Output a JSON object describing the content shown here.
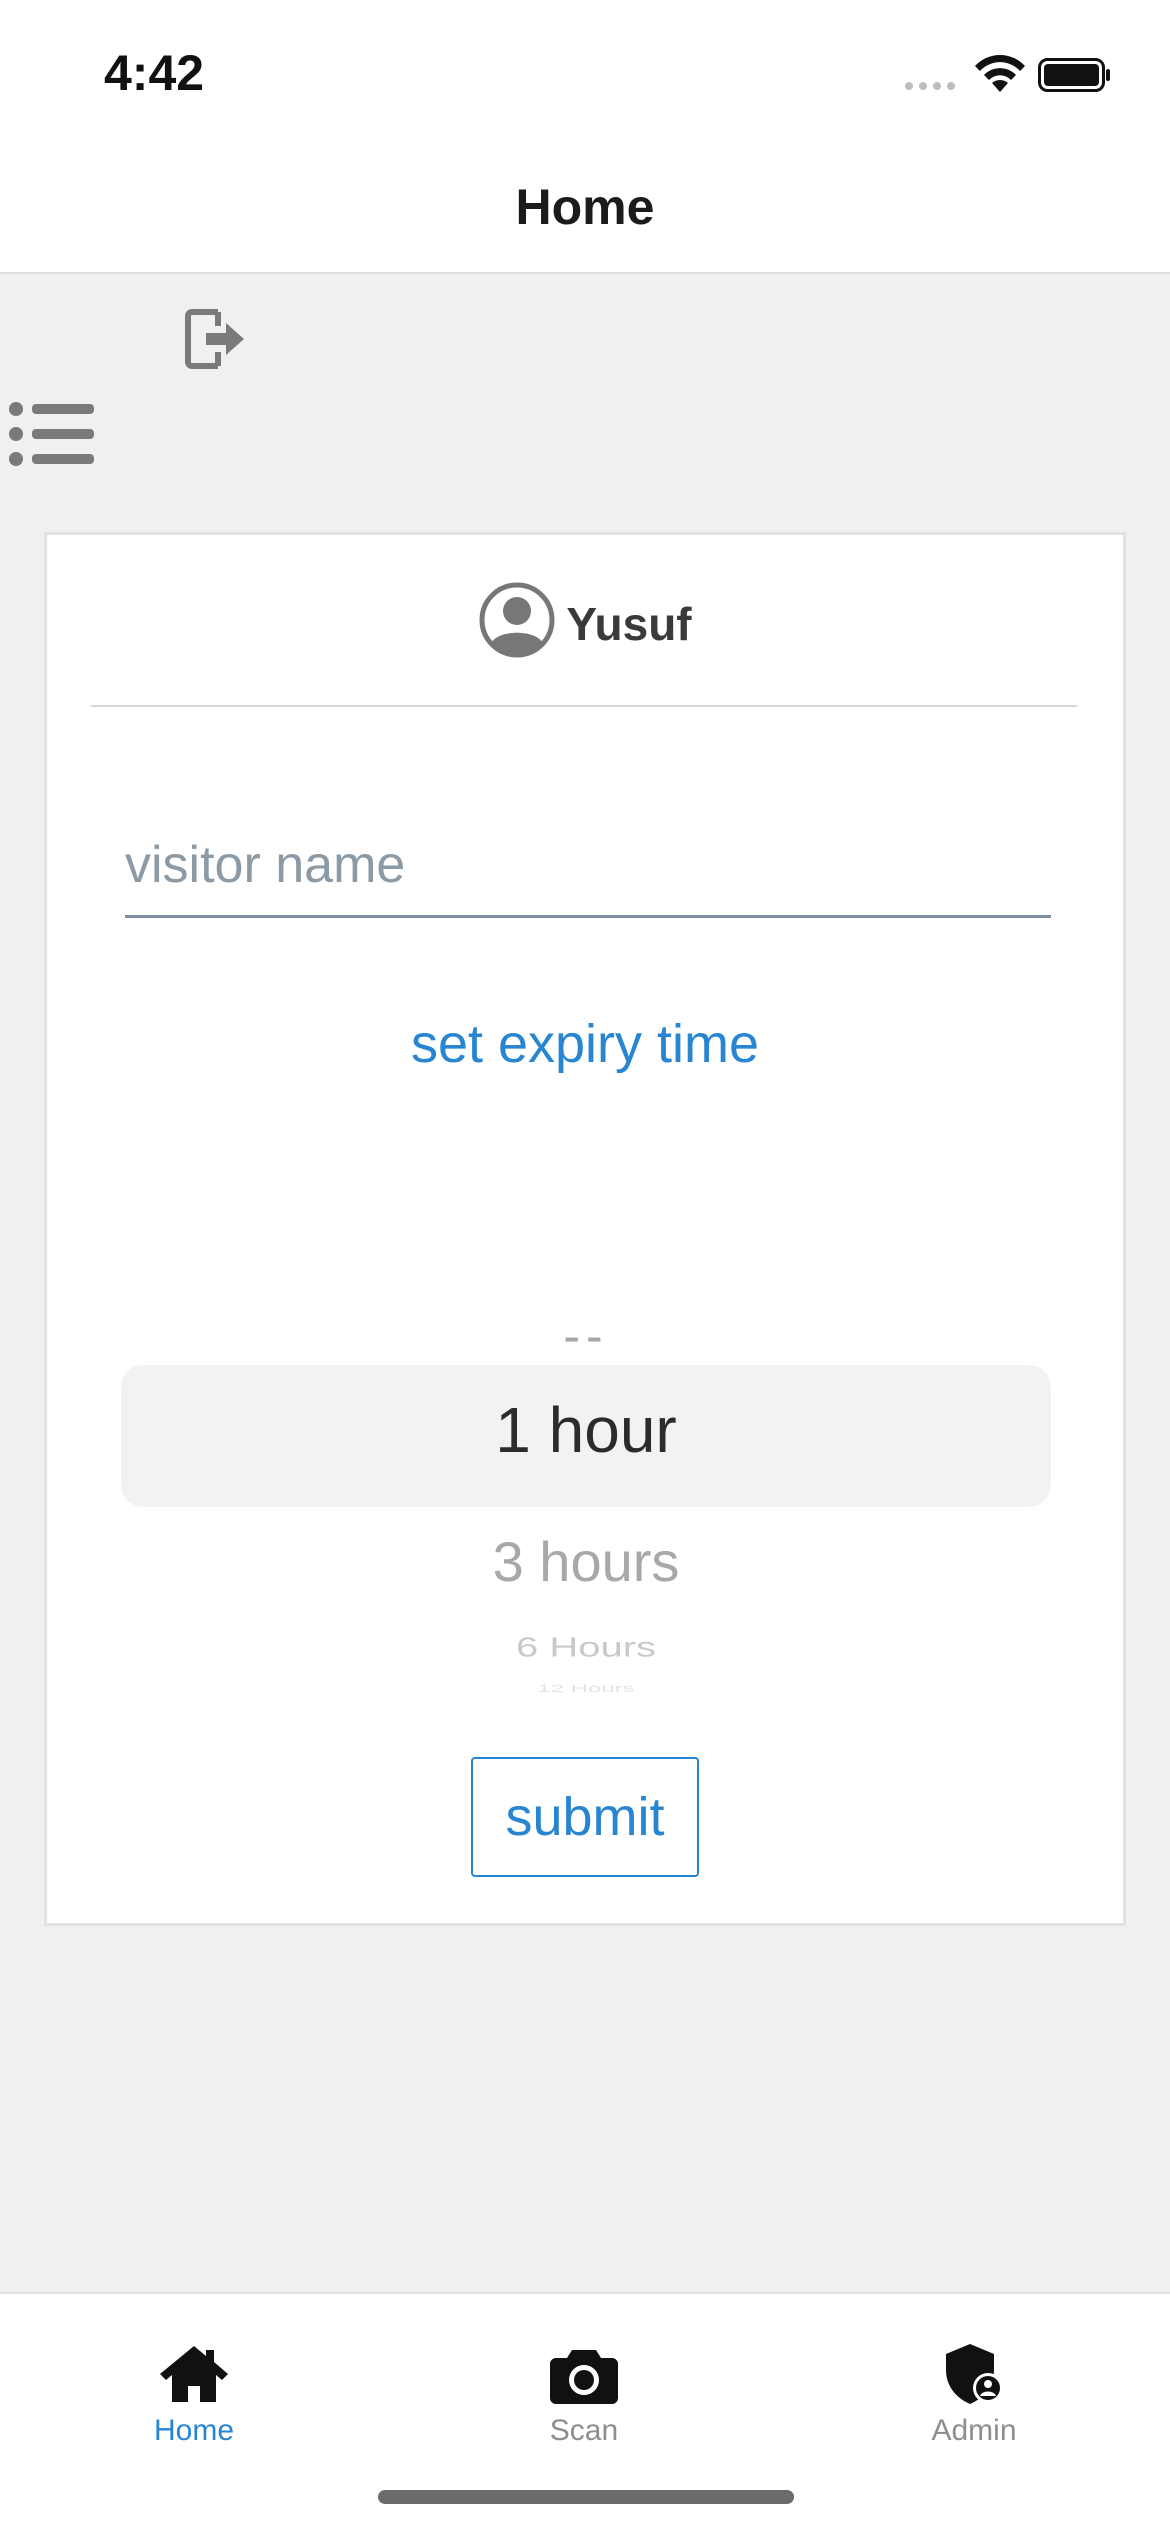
{
  "status_bar": {
    "time": "4:42"
  },
  "header": {
    "title": "Home"
  },
  "toolbar": {
    "logout_icon": "logout-icon",
    "menu_icon": "list-icon"
  },
  "card": {
    "user": {
      "name": "Yusuf",
      "avatar_icon": "user-circle-icon"
    },
    "visitor_input": {
      "placeholder": "visitor name",
      "value": ""
    },
    "expiry_link": "set expiry time",
    "picker": {
      "options": [
        "--",
        "1 hour",
        "3 hours",
        "6 Hours",
        "12 Hours"
      ],
      "selected": "1 hour"
    },
    "submit_label": "submit"
  },
  "tab_bar": {
    "tabs": [
      {
        "label": "Home",
        "icon": "home-icon",
        "active": true
      },
      {
        "label": "Scan",
        "icon": "camera-icon",
        "active": false
      },
      {
        "label": "Admin",
        "icon": "admin-shield-icon",
        "active": false
      }
    ]
  },
  "colors": {
    "accent": "#2785d2",
    "background": "#f0f0f0",
    "card": "#ffffff",
    "inactive_tab": "#8e8e8e"
  }
}
